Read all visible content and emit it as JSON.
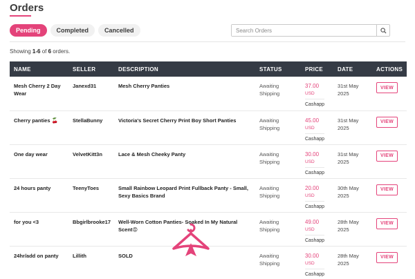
{
  "page": {
    "title": "Orders",
    "tabs": [
      {
        "label": "Pending",
        "active": true
      },
      {
        "label": "Completed",
        "active": false
      },
      {
        "label": "Cancelled",
        "active": false
      }
    ],
    "search_placeholder": "Search Orders",
    "showing": {
      "prefix": "Showing ",
      "range": "1-6",
      "of": " of ",
      "total": "6",
      "suffix": " orders."
    }
  },
  "table": {
    "headers": [
      "NAME",
      "SELLER",
      "DESCRIPTION",
      "STATUS",
      "PRICE",
      "DATE",
      "ACTIONS"
    ],
    "rows": [
      {
        "name": "Mesh Cherry 2 Day Wear",
        "seller": "Janexd31",
        "description": "Mesh Cherry Panties",
        "status": "Awaiting Shipping",
        "price": "37.00",
        "currency": "USD",
        "payment": "Cashapp",
        "date": "31st May 2025",
        "action": "VIEW"
      },
      {
        "name": "Cherry panties 🍒",
        "seller": "StellaBunny",
        "description": "Victoria's Secret Cherry Print Boy Short Panties",
        "status": "Awaiting Shipping",
        "price": "45.00",
        "currency": "USD",
        "payment": "Cashapp",
        "date": "31st May 2025",
        "action": "VIEW"
      },
      {
        "name": "One day wear",
        "seller": "VelvetKitt3n",
        "description": "Lace & Mesh Cheeky Panty",
        "status": "Awaiting Shipping",
        "price": "30.00",
        "currency": "USD",
        "payment": "Cashapp",
        "date": "31st May 2025",
        "action": "VIEW"
      },
      {
        "name": "24 hours panty",
        "seller": "TeenyToes",
        "description": "Small Rainbow Leopard Print Fullback Panty - Small, Sexy Basics Brand",
        "status": "Awaiting Shipping",
        "price": "20.00",
        "currency": "USD",
        "payment": "Cashapp",
        "date": "30th May 2025",
        "action": "VIEW"
      },
      {
        "name": "for you <3",
        "seller": "Bbgirlbrooke17",
        "description": "Well-Worn Cotton Panties- Soaked In My Natural Scent😡",
        "status": "Awaiting Shipping",
        "price": "49.00",
        "currency": "USD",
        "payment": "Cashapp",
        "date": "28th May 2025",
        "action": "VIEW"
      },
      {
        "name": "24hr/add on panty",
        "seller": "Lillith",
        "description": "SOLD",
        "status": "Awaiting Shipping",
        "price": "30.00",
        "currency": "USD",
        "payment": "Cashapp",
        "date": "28th May 2025",
        "action": "VIEW"
      }
    ]
  },
  "colors": {
    "accent": "#e4437a",
    "header_bg": "#353b45"
  },
  "icons": {
    "search": "search-icon",
    "watermark": "hanger-logo-icon"
  }
}
